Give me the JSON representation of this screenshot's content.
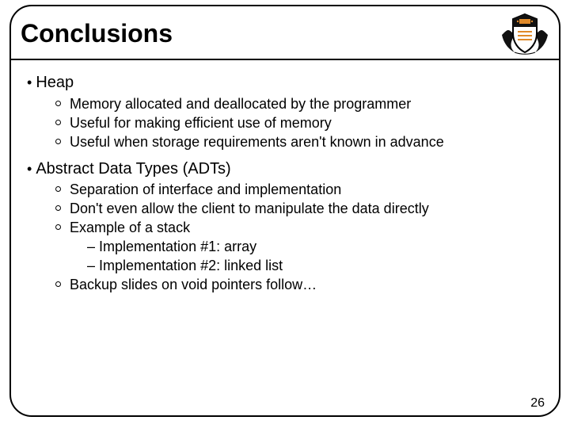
{
  "title": "Conclusions",
  "crest_name": "princeton-shield",
  "sections": [
    {
      "heading": "Heap",
      "items": [
        {
          "text": "Memory allocated and deallocated by the programmer"
        },
        {
          "text": "Useful for making efficient use of memory"
        },
        {
          "text": "Useful when storage requirements aren't known in advance"
        }
      ]
    },
    {
      "heading": "Abstract Data Types (ADTs)",
      "items": [
        {
          "text": "Separation of interface and implementation"
        },
        {
          "text": "Don't even allow the client to manipulate the data directly"
        },
        {
          "text": "Example of a stack",
          "sub": [
            "Implementation #1: array",
            "Implementation #2: linked list"
          ]
        },
        {
          "text": "Backup slides on void pointers follow…"
        }
      ]
    }
  ],
  "page_number": "26"
}
